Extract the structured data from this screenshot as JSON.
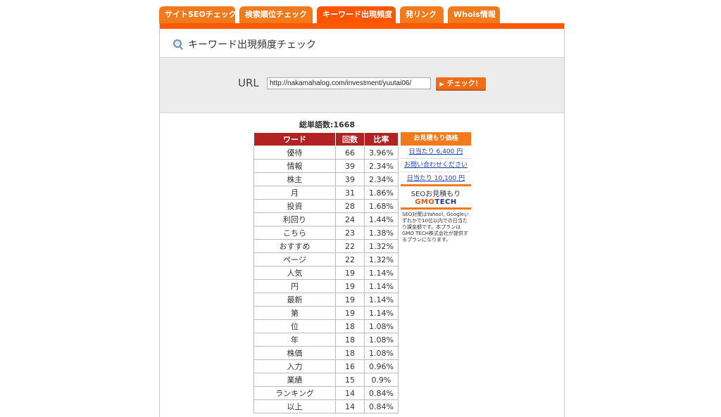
{
  "tabs": [
    {
      "label": "サイトSEOチェック",
      "active": false
    },
    {
      "label": "検索順位チェック",
      "active": false
    },
    {
      "label": "キーワード出現頻度",
      "active": true
    },
    {
      "label": "発リンク",
      "active": false
    },
    {
      "label": "Whois情報",
      "active": false
    }
  ],
  "page_title": "キーワード出現頻度チェック",
  "url_form": {
    "label": "URL",
    "value": "http://nakamahalog.com/investment/yuutai06/",
    "button_label": "チェック！"
  },
  "total_words": "総単語数:1668",
  "table": {
    "headers": [
      "ワード",
      "回数",
      "比率"
    ],
    "rows": [
      [
        "優待",
        "66",
        "3.96%"
      ],
      [
        "情報",
        "39",
        "2.34%"
      ],
      [
        "株主",
        "39",
        "2.34%"
      ],
      [
        "月",
        "31",
        "1.86%"
      ],
      [
        "投資",
        "28",
        "1.68%"
      ],
      [
        "利回り",
        "24",
        "1.44%"
      ],
      [
        "こちら",
        "23",
        "1.38%"
      ],
      [
        "おすすめ",
        "22",
        "1.32%"
      ],
      [
        "ページ",
        "22",
        "1.32%"
      ],
      [
        "人気",
        "19",
        "1.14%"
      ],
      [
        "円",
        "19",
        "1.14%"
      ],
      [
        "最新",
        "19",
        "1.14%"
      ],
      [
        "第",
        "19",
        "1.14%"
      ],
      [
        "位",
        "18",
        "1.08%"
      ],
      [
        "年",
        "18",
        "1.08%"
      ],
      [
        "株価",
        "18",
        "1.08%"
      ],
      [
        "入力",
        "16",
        "0.96%"
      ],
      [
        "業績",
        "15",
        "0.9%"
      ],
      [
        "ランキング",
        "14",
        "0.84%"
      ],
      [
        "以上",
        "14",
        "0.84%"
      ]
    ]
  },
  "price_box": {
    "header": "お見積もり価格",
    "links": [
      "日当たり 6,400 円",
      "お問い合わせください",
      "日当たり 10,100 円"
    ],
    "seo_quote": "SEOお見積もり",
    "logo_main": "GMO",
    "logo_sub": "TECH",
    "note": "SEO対策はYahoo!, Googleいずれかで10位以内での日当たり課金額です。本プランはGMO TECH株式会社が提供するプランになります。"
  },
  "colors": {
    "tab": "#f07a1c",
    "tab_active": "#ff5500",
    "table_header": "#b22222",
    "link": "#1f3fb0"
  }
}
